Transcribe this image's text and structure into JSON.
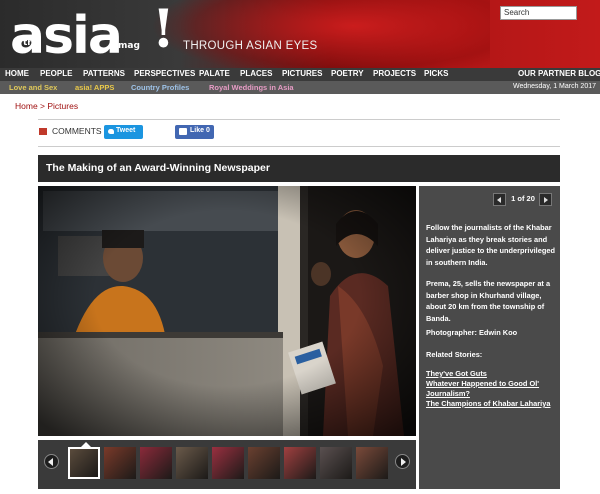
{
  "header": {
    "logo_the": "the",
    "logo_asia": "asia",
    "logo_mag": "mag",
    "logo_bang": "!",
    "tagline": "THROUGH ASIAN EYES",
    "search_placeholder": "Search"
  },
  "nav": {
    "items": [
      "HOME",
      "PEOPLE",
      "PATTERNS",
      "PERSPECTIVES",
      "PALATE",
      "PLACES",
      "PICTURES",
      "POETRY",
      "PROJECTS",
      "PICKS"
    ],
    "partner": "OUR PARTNER BLOGS"
  },
  "subnav": {
    "items": [
      "Love and Sex",
      "asia! APPS",
      "Country Profiles",
      "Royal Weddings in Asia"
    ],
    "date": "Wednesday, 1 March 2017"
  },
  "breadcrumb": {
    "home": "Home",
    "sep": " > ",
    "current": "Pictures"
  },
  "social": {
    "comments": "COMMENTS",
    "tweet": "Tweet",
    "like": "Like 0"
  },
  "gallery": {
    "title": "The Making of an Award-Winning Newspaper",
    "counter": "1 of 20",
    "intro": "Follow the journalists of the Khabar Lahariya as they break stories and deliver justice to the underprivileged in southern India.",
    "caption": "Prema, 25, sells the newspaper at a barber shop in Khurhand village, about 20 km from the township of Banda.",
    "photographer": "Photographer: Edwin Koo",
    "related_label": "Related Stories:",
    "related": [
      "They've Got Guts",
      "Whatever Happened to Good Ol' Journalism?",
      "The Champions of Khabar Lahariya"
    ],
    "thumb_count": 9
  },
  "colors": {
    "brand_red": "#b01616",
    "nav_bg": "#3a3a3a",
    "panel_bg": "#4a4a4a",
    "link_red": "#a01010"
  }
}
